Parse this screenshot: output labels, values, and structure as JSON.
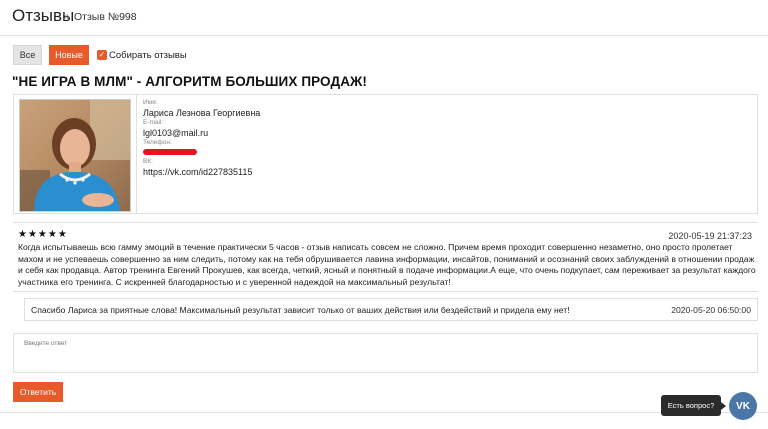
{
  "header": {
    "title": "Отзывы",
    "separator": "»",
    "breadcrumb": "Отзыв №998"
  },
  "filters": {
    "all_label": "Все",
    "new_label": "Новые",
    "collect_label": "Собирать отзывы",
    "collect_checked": true
  },
  "product_title": "\"НЕ ИГРА В МЛМ\" - АЛГОРИТМ БОЛЬШИХ ПРОДАЖ!",
  "author": {
    "name_label": "Имя:",
    "name": "Лариса Лезнова Георгиевна",
    "email_label": "E-mail:",
    "email": "lgl0103@mail.ru",
    "phone_label": "Телефон:",
    "vk_label": "ВК:",
    "vk": "https://vk.com/id227835115"
  },
  "review": {
    "stars": "★★★★★",
    "rating": 5,
    "date": "2020-05-19 21:37:23",
    "text": "Когда испытываешь всю гамму эмоций в течение практически 5 часов - отзыв написать совсем не сложно. Причем время проходит совершенно незаметно, оно просто пролетает махом и не успеваешь совершенно за ним следить, потому как на тебя обрушивается лавина информации, инсайтов, пониманий и осознаний своих заблуждений в отношении продаж и себя как продавца. Автор тренинга Евгений Прокушев, как всегда, четкий, ясный и понятный в подаче информации.А еще, что очень подкупает, сам переживает за результат каждого участника его тренинга. С искренней благодарностью и с уверенной надеждой на максимальный результат!"
  },
  "reply": {
    "text": "Спасибо Лариса за приятные слова! Максимальный результат зависит только от ваших действия или бездействий и придела ему нет!",
    "date": "2020-05-20 06:50:00"
  },
  "answer_form": {
    "placeholder": "Введите ответ",
    "submit_label": "Ответить"
  },
  "widget": {
    "tooltip": "Есть вопрос?",
    "vk_label": "VK",
    "accent": "#4a76a8"
  },
  "colors": {
    "accent": "#e95a2b"
  }
}
